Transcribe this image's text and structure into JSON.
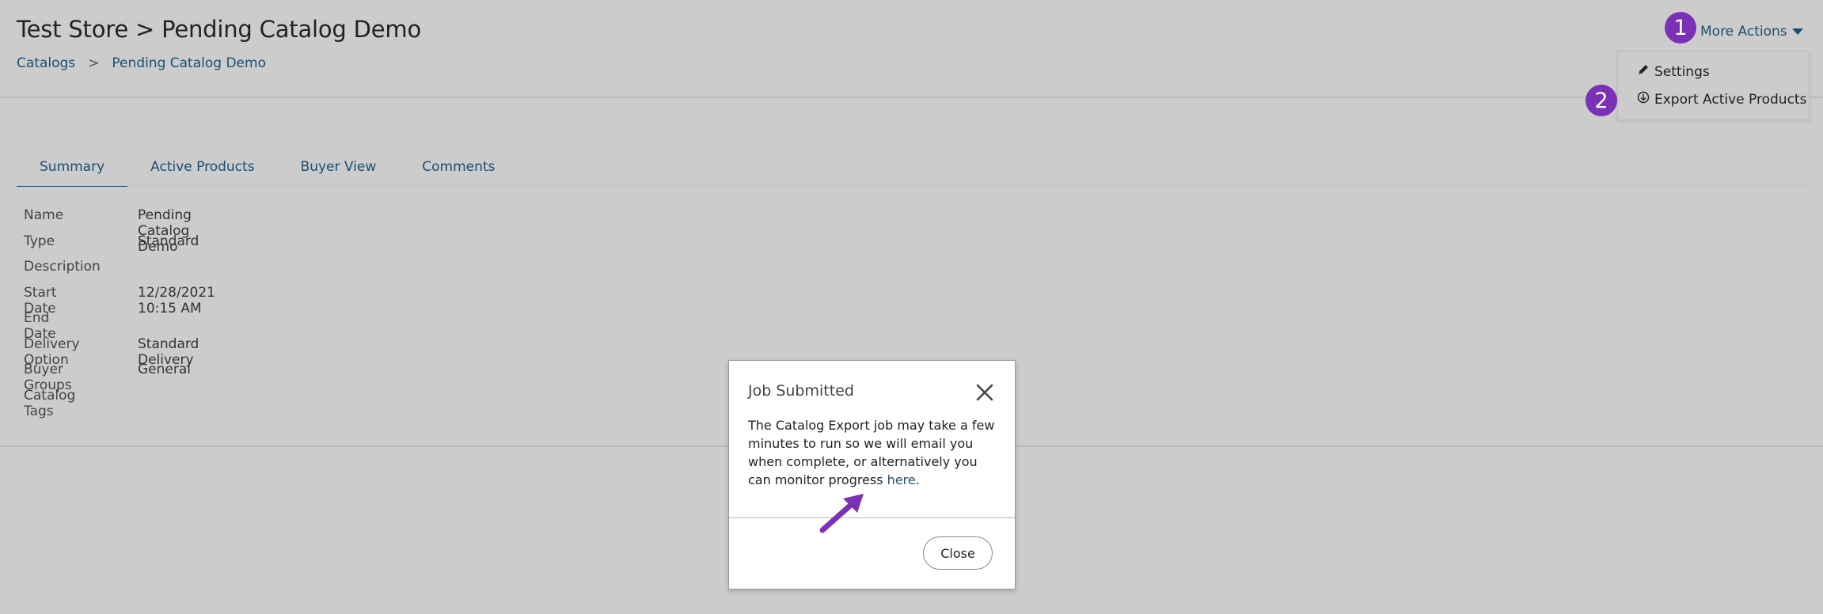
{
  "header": {
    "title": "Test Store > Pending Catalog Demo",
    "breadcrumb": [
      "Catalogs",
      ">",
      "Pending Catalog Demo"
    ],
    "more_actions_label": "More Actions"
  },
  "dropdown": {
    "items": [
      {
        "label": "Settings",
        "icon": "pencil-icon"
      },
      {
        "label": "Export Active Products",
        "icon": "download-circle-icon"
      }
    ]
  },
  "annotations": {
    "badge_1": "1",
    "badge_2": "2",
    "badge_color": "#7b31b5"
  },
  "tabs": [
    {
      "label": "Summary",
      "active": true
    },
    {
      "label": "Active Products",
      "active": false
    },
    {
      "label": "Buyer View",
      "active": false
    },
    {
      "label": "Comments",
      "active": false
    }
  ],
  "details": [
    {
      "label": "Name",
      "value": "Pending Catalog Demo"
    },
    {
      "label": "Type",
      "value": "Standard"
    },
    {
      "label": "Description",
      "value": ""
    },
    {
      "label": "Start Date",
      "value": "12/28/2021 10:15 AM"
    },
    {
      "label": "End Date",
      "value": ""
    },
    {
      "label": "Delivery Option",
      "value": "Standard Delivery"
    },
    {
      "label": "Buyer Groups",
      "value": "General"
    },
    {
      "label": "Catalog Tags",
      "value": ""
    }
  ],
  "modal": {
    "title": "Job Submitted",
    "body_text": "The Catalog Export job may take a few minutes to run so we will email you when complete, or alternatively you can monitor progress ",
    "link_text": "here",
    "body_end": ".",
    "close_label": "Close"
  },
  "colors": {
    "link": "#1d4e6e",
    "background": "#cccccc"
  }
}
